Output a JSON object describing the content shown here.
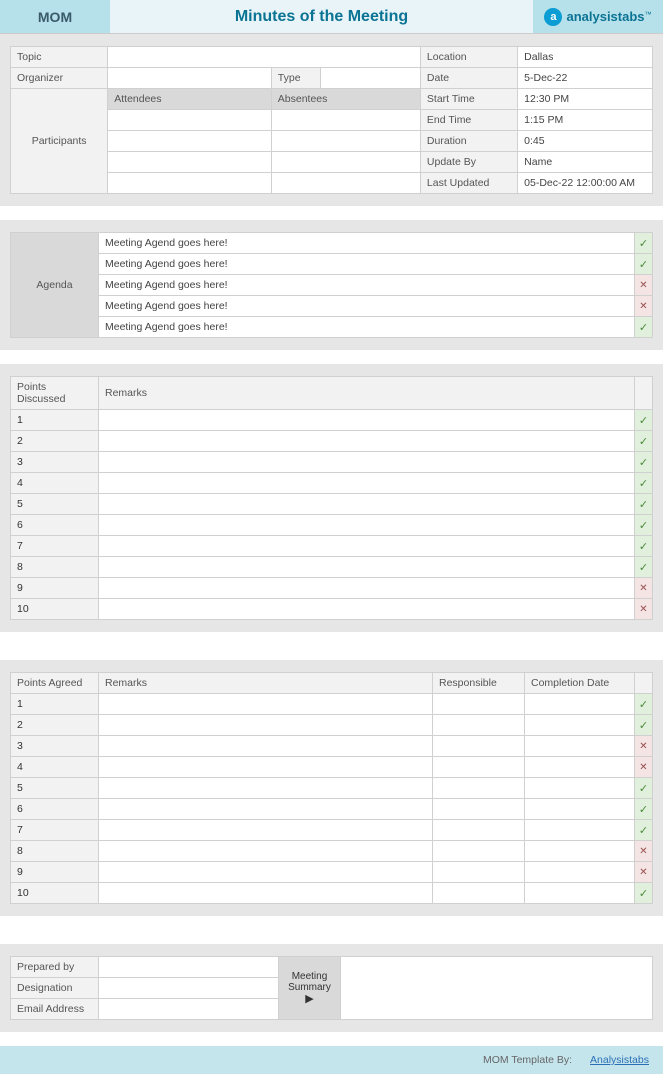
{
  "header": {
    "mom": "MOM",
    "title": "Minutes of the Meeting",
    "logo_text": "analysistabs",
    "logo_tm": "™"
  },
  "info": {
    "topic_label": "Topic",
    "topic": "",
    "organizer_label": "Organizer",
    "organizer": "",
    "type_label": "Type",
    "type": "",
    "participants_label": "Participants",
    "attendees_label": "Attendees",
    "absentees_label": "Absentees",
    "location_label": "Location",
    "location": "Dallas",
    "date_label": "Date",
    "date": "5-Dec-22",
    "start_time_label": "Start Time",
    "start_time": "12:30 PM",
    "end_time_label": "End Time",
    "end_time": "1:15 PM",
    "duration_label": "Duration",
    "duration": "0:45",
    "update_by_label": "Update By",
    "update_by": "Name",
    "last_updated_label": "Last Updated",
    "last_updated": "05-Dec-22 12:00:00 AM"
  },
  "agenda": {
    "label": "Agenda",
    "items": [
      {
        "text": "Meeting Agend goes here!",
        "status": "check"
      },
      {
        "text": "Meeting Agend goes here!",
        "status": "check"
      },
      {
        "text": "Meeting Agend goes here!",
        "status": "cross"
      },
      {
        "text": "Meeting Agend goes here!",
        "status": "cross"
      },
      {
        "text": "Meeting Agend goes here!",
        "status": "check"
      }
    ]
  },
  "points_discussed": {
    "header_num": "Points Discussed",
    "header_remarks": "Remarks",
    "rows": [
      {
        "n": "1",
        "r": "",
        "s": "check"
      },
      {
        "n": "2",
        "r": "",
        "s": "check"
      },
      {
        "n": "3",
        "r": "",
        "s": "check"
      },
      {
        "n": "4",
        "r": "",
        "s": "check"
      },
      {
        "n": "5",
        "r": "",
        "s": "check"
      },
      {
        "n": "6",
        "r": "",
        "s": "check"
      },
      {
        "n": "7",
        "r": "",
        "s": "check"
      },
      {
        "n": "8",
        "r": "",
        "s": "check"
      },
      {
        "n": "9",
        "r": "",
        "s": "cross"
      },
      {
        "n": "10",
        "r": "",
        "s": "cross"
      }
    ]
  },
  "points_agreed": {
    "header_num": "Points Agreed",
    "header_remarks": "Remarks",
    "header_resp": "Responsible",
    "header_date": "Completion Date",
    "rows": [
      {
        "n": "1",
        "r": "",
        "p": "",
        "d": "",
        "s": "check"
      },
      {
        "n": "2",
        "r": "",
        "p": "",
        "d": "",
        "s": "check"
      },
      {
        "n": "3",
        "r": "",
        "p": "",
        "d": "",
        "s": "cross"
      },
      {
        "n": "4",
        "r": "",
        "p": "",
        "d": "",
        "s": "cross"
      },
      {
        "n": "5",
        "r": "",
        "p": "",
        "d": "",
        "s": "check"
      },
      {
        "n": "6",
        "r": "",
        "p": "",
        "d": "",
        "s": "check"
      },
      {
        "n": "7",
        "r": "",
        "p": "",
        "d": "",
        "s": "check"
      },
      {
        "n": "8",
        "r": "",
        "p": "",
        "d": "",
        "s": "cross"
      },
      {
        "n": "9",
        "r": "",
        "p": "",
        "d": "",
        "s": "cross"
      },
      {
        "n": "10",
        "r": "",
        "p": "",
        "d": "",
        "s": "check"
      }
    ]
  },
  "footer_block": {
    "prepared_by_label": "Prepared by",
    "prepared_by": "",
    "designation_label": "Designation",
    "designation": "",
    "email_label": "Email Address",
    "email": "",
    "summary_label": "Meeting Summary",
    "summary": ""
  },
  "footer": {
    "template_by": "MOM Template By:",
    "link": "Analysistabs"
  },
  "glyphs": {
    "check": "✓",
    "cross": "✕",
    "arrow": "▶"
  }
}
